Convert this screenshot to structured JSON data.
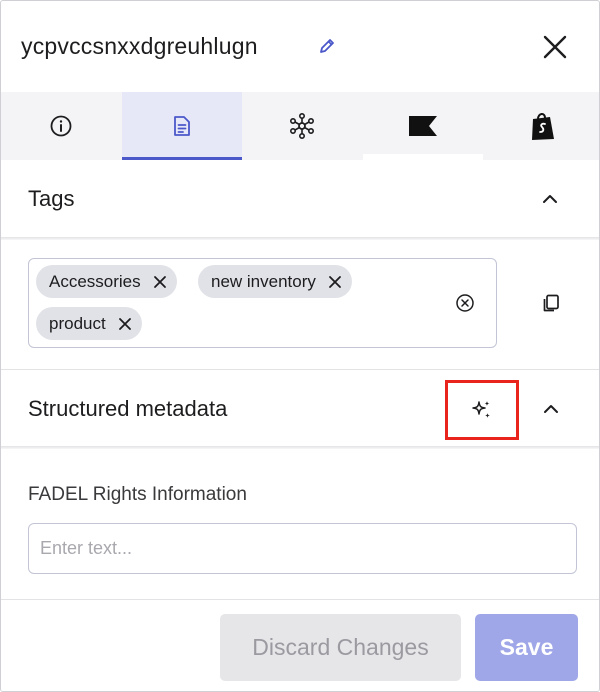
{
  "header": {
    "title": "ycpvccsnxxdgreuhlugn",
    "edit_icon": "pencil-icon",
    "close_icon": "close-icon"
  },
  "tabs": [
    {
      "icon": "info-icon",
      "active": false
    },
    {
      "icon": "document-icon",
      "active": true
    },
    {
      "icon": "network-icon",
      "active": false
    },
    {
      "icon": "flag-icon",
      "active": false
    },
    {
      "icon": "shopify-bag-icon",
      "active": false
    }
  ],
  "tags_section": {
    "title": "Tags",
    "chips": [
      {
        "label": "Accessories"
      },
      {
        "label": "new inventory"
      },
      {
        "label": "product"
      }
    ]
  },
  "metadata_section": {
    "title": "Structured metadata",
    "fields": [
      {
        "label": "FADEL Rights Information",
        "value": "",
        "placeholder": "Enter text..."
      }
    ]
  },
  "footer": {
    "discard_label": "Discard Changes",
    "save_label": "Save"
  },
  "colors": {
    "accent": "#4b58c9",
    "active_tab_bg": "#e6e8f8",
    "save_button_bg": "#a0a7e8",
    "highlight_box": "#e8241c"
  }
}
